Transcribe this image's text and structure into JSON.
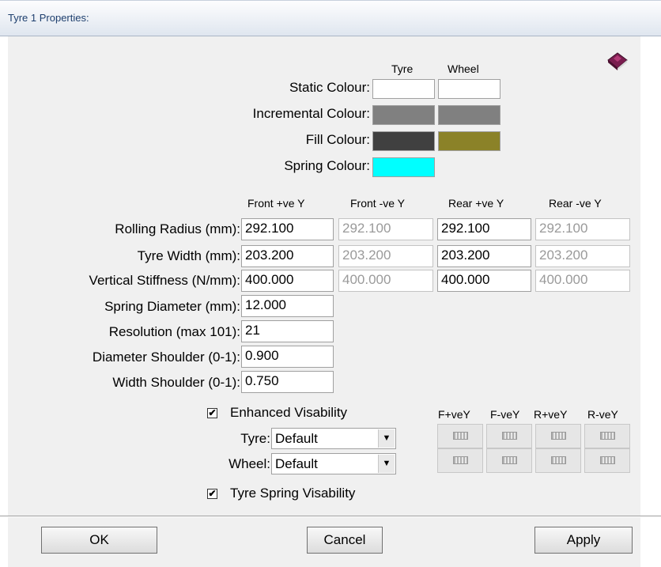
{
  "window": {
    "title": "Tyre 1 Properties:"
  },
  "colours": {
    "columns": [
      "Tyre",
      "Wheel"
    ],
    "rows": [
      {
        "label": "Static Colour:",
        "tyre": "#ffffff",
        "wheel": "#ffffff"
      },
      {
        "label": "Incremental Colour:",
        "tyre": "#808080",
        "wheel": "#808080"
      },
      {
        "label": "Fill Colour:",
        "tyre": "#404040",
        "wheel": "#8b8228"
      },
      {
        "label": "Spring Colour:",
        "tyre": "#00ffff"
      }
    ]
  },
  "dimensions": {
    "columns": [
      "Front +ve Y",
      "Front -ve Y",
      "Rear +ve Y",
      "Rear -ve Y"
    ],
    "rows": [
      {
        "label": "Rolling Radius (mm):",
        "values": [
          "292.100",
          "292.100",
          "292.100",
          "292.100"
        ]
      },
      {
        "label": "Tyre Width (mm):",
        "values": [
          "203.200",
          "203.200",
          "203.200",
          "203.200"
        ]
      },
      {
        "label": "Vertical Stiffness (N/mm):",
        "values": [
          "400.000",
          "400.000",
          "400.000",
          "400.000"
        ]
      }
    ],
    "single_rows": [
      {
        "label": "Spring Diameter (mm):",
        "value": "12.000"
      },
      {
        "label": "Resolution (max 101):",
        "value": "21"
      },
      {
        "label": "Diameter Shoulder (0-1):",
        "value": "0.900"
      },
      {
        "label": "Width Shoulder (0-1):",
        "value": "0.750"
      }
    ]
  },
  "enhanced": {
    "label": "Enhanced Visability",
    "checked": true,
    "mark": "✔"
  },
  "style": {
    "tyre_label": "Tyre:",
    "tyre_value": "Default",
    "wheel_label": "Wheel:",
    "wheel_value": "Default",
    "arrow": "▼"
  },
  "grid": {
    "columns": [
      "F+veY",
      "F-veY",
      "R+veY",
      "R-veY"
    ]
  },
  "spring_vis": {
    "label": "Tyre Spring Visability",
    "checked": true,
    "mark": "✔"
  },
  "buttons": {
    "ok": "OK",
    "cancel": "Cancel",
    "apply": "Apply"
  },
  "icons": {
    "help": "help-book-icon"
  }
}
